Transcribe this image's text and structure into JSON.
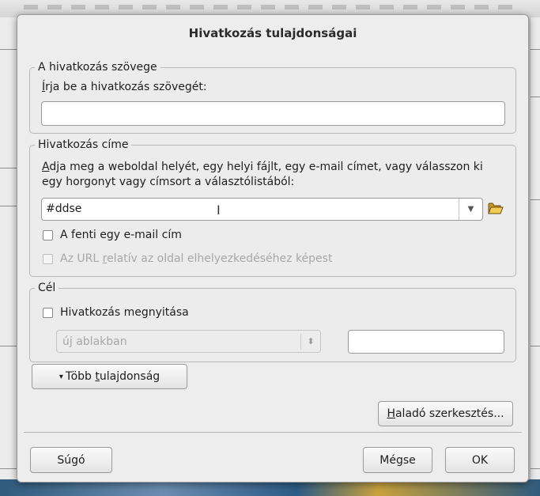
{
  "dialog": {
    "title": "Hivatkozás tulajdonságai"
  },
  "link_text_group": {
    "legend": "A hivatkozás szövege",
    "prompt_accel": "Í",
    "prompt_rest": "rja be a hivatkozás szövegét:",
    "value": ""
  },
  "link_address_group": {
    "legend": "Hivatkozás címe",
    "prompt_line1_accel": "A",
    "prompt_line1_rest": "dja meg a weboldal helyét, egy helyi fájlt, egy e-mail címet, vagy válasszon ki",
    "prompt_line2": "egy horgonyt vagy címsort a választólistából:",
    "value": "#ddse",
    "email_checkbox": {
      "label": "A fenti egy e-mail cím",
      "checked": false
    },
    "relative_checkbox": {
      "label_before": "Az URL ",
      "label_accel": "r",
      "label_after": "elatív az oldal elhelyezkedéséhez képest",
      "checked": false,
      "disabled": true
    }
  },
  "target_group": {
    "legend": "Cél",
    "open_checkbox": {
      "label": "Hivatkozás megnyitása",
      "checked": false
    },
    "window_select": {
      "value": "új ablakban",
      "disabled": true
    },
    "frame_name": ""
  },
  "buttons": {
    "more_props_arrow": "▾",
    "more_props_before": "Több ",
    "more_props_accel": "t",
    "more_props_after": "ulajdonság",
    "advanced_accel": "H",
    "advanced_rest": "aladó szerkesztés...",
    "help": "Súgó",
    "cancel": "Mégse",
    "ok": "OK"
  },
  "icons": {
    "folder": "open-folder-icon",
    "dropdown": "chevron-down-icon",
    "spinner": "up-down-arrows-icon",
    "cursor": "text-cursor-icon"
  },
  "colors": {
    "dialog_bg": "#ededed",
    "folder_yellow": "#e9b840"
  }
}
